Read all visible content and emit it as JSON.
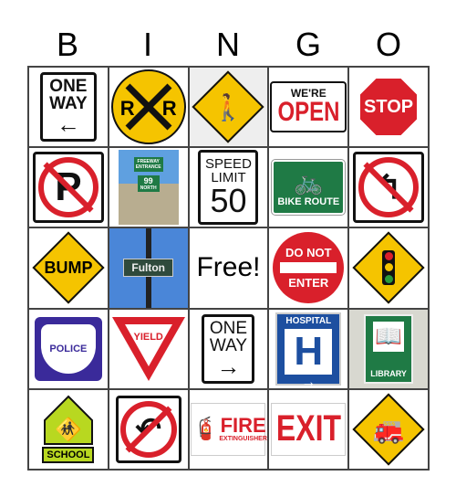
{
  "header": [
    "B",
    "I",
    "N",
    "G",
    "O"
  ],
  "cells": {
    "one_way_left": [
      "ONE",
      "WAY"
    ],
    "railroad": [
      "R",
      "R"
    ],
    "were_open": [
      "WE'RE",
      "OPEN"
    ],
    "stop": "STOP",
    "freeway": [
      "FREEWAY",
      "ENTRANCE",
      "99",
      "NORTH"
    ],
    "speed": [
      "SPEED",
      "LIMIT",
      "50"
    ],
    "bike": "BIKE ROUTE",
    "bump": "BUMP",
    "fulton": "Fulton",
    "free": "Free!",
    "dne": [
      "DO NOT",
      "ENTER"
    ],
    "police": "POLICE",
    "yield": "YIELD",
    "one_way_right": [
      "ONE",
      "WAY"
    ],
    "hospital": [
      "HOSPITAL",
      "H"
    ],
    "library": "LIBRARY",
    "school": "SCHOOL",
    "fire": [
      "FIRE",
      "EXTINGUISHER"
    ],
    "exit": "EXIT"
  },
  "colors": {
    "yellow": "#f5c400",
    "red": "#d9202b",
    "green": "#1f7a45",
    "blue": "#1d4fa0",
    "purple": "#3a2a9a"
  }
}
